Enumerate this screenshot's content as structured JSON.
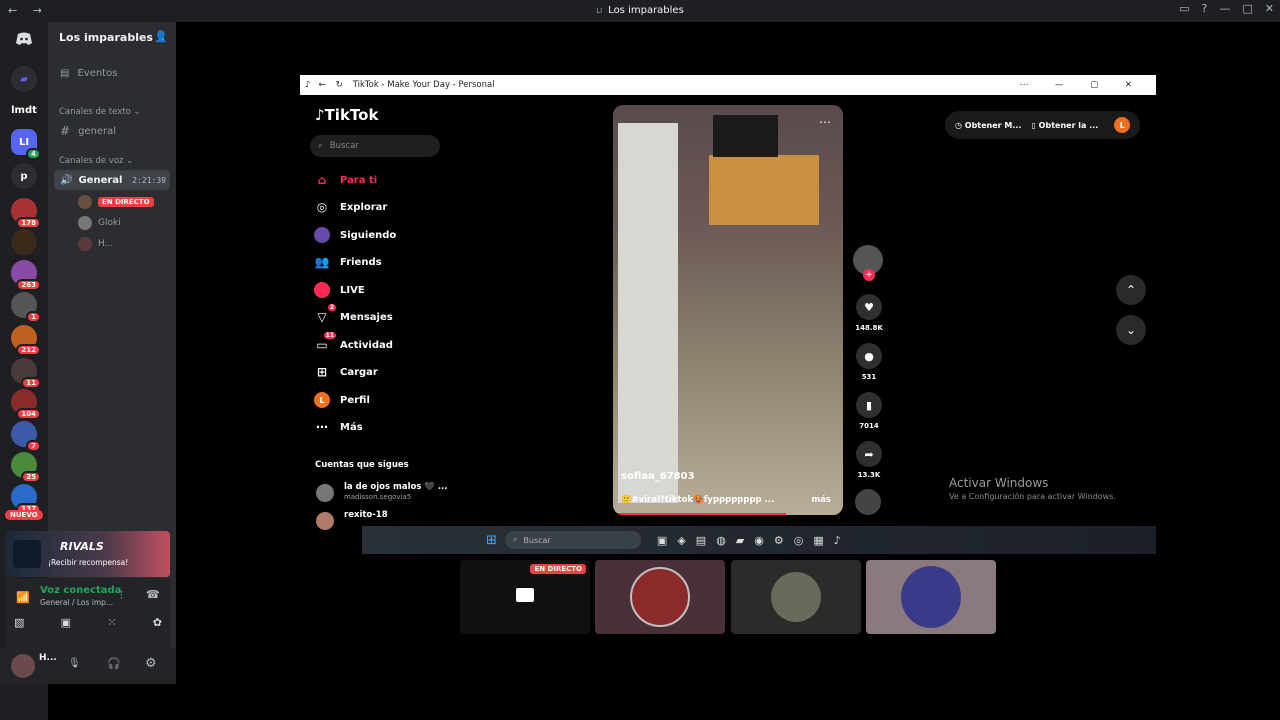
{
  "window": {
    "title": "Los imparables",
    "title_prefix": "LI",
    "nav": "← →"
  },
  "guild_rail": {
    "items": [
      {
        "label": "",
        "badge": ""
      },
      {
        "label": "",
        "badge": ""
      },
      {
        "label": "lmdt",
        "badge": ""
      },
      {
        "label": "LI",
        "badge": "4"
      },
      {
        "label": "p",
        "badge": ""
      },
      {
        "label": "",
        "badge": "178"
      },
      {
        "label": "",
        "badge": ""
      },
      {
        "label": "",
        "badge": "263"
      },
      {
        "label": "",
        "badge": "1"
      },
      {
        "label": "",
        "badge": "212"
      },
      {
        "label": "",
        "badge": "11"
      },
      {
        "label": "",
        "badge": "104"
      },
      {
        "label": "",
        "badge": "7"
      },
      {
        "label": "",
        "badge": "25"
      },
      {
        "label": "",
        "badge": "137"
      }
    ],
    "new_label": "NUEVO"
  },
  "channels": {
    "server_name": "Los imparables",
    "events": "Eventos",
    "text_category": "Canales de texto",
    "text_channel": "general",
    "voice_category": "Canales de voz",
    "voice_channel": "General",
    "voice_timer": "2:21:39",
    "live_label": "EN DIRECTO",
    "voice_users": [
      "Gloki",
      "H..."
    ]
  },
  "promo": {
    "brand": "RIVALS",
    "text": "¡Recibir recompensa!"
  },
  "voice_panel": {
    "status": "Voz conectada",
    "location": "General / Los imp..."
  },
  "user_panel": {
    "name": "H..."
  },
  "browser": {
    "title": "TikTok - Make Your Day - Personal",
    "logo": "TikTok",
    "search_placeholder": "Buscar",
    "menu": [
      {
        "label": "Para ti",
        "icon": "home-icon",
        "badge": ""
      },
      {
        "label": "Explorar",
        "icon": "compass-icon",
        "badge": ""
      },
      {
        "label": "Siguiendo",
        "icon": "following-icon",
        "badge": ""
      },
      {
        "label": "Friends",
        "icon": "friends-icon",
        "badge": ""
      },
      {
        "label": "LIVE",
        "icon": "live-icon",
        "badge": ""
      },
      {
        "label": "Mensajes",
        "icon": "messages-icon",
        "badge": "2"
      },
      {
        "label": "Actividad",
        "icon": "activity-icon",
        "badge": "11"
      },
      {
        "label": "Cargar",
        "icon": "upload-icon",
        "badge": ""
      },
      {
        "label": "Perfil",
        "icon": "profile-icon",
        "badge": ""
      },
      {
        "label": "Más",
        "icon": "more-icon",
        "badge": ""
      }
    ],
    "following_title": "Cuentas que sigues",
    "following": [
      {
        "name": "la de ojos malos 🖤 ...",
        "handle": "madisson.segovia5"
      },
      {
        "name": "rexito-18",
        "handle": ""
      }
    ],
    "video": {
      "username": "sofiaa_67803",
      "caption": "🙂#viral?tiktok🥵fypppppppp ...",
      "more": "más"
    },
    "actions": {
      "likes": "148.8K",
      "comments": "531",
      "saves": "7014",
      "shares": "13.3K"
    },
    "get_app": [
      "Obtener M...",
      "Obtener la ..."
    ],
    "watermark_title": "Activar Windows",
    "watermark_sub": "Ve a Configuración para activar Windows.",
    "taskbar_search": "Buscar"
  },
  "stream_tiles": {
    "live_label": "EN DIRECTO"
  }
}
